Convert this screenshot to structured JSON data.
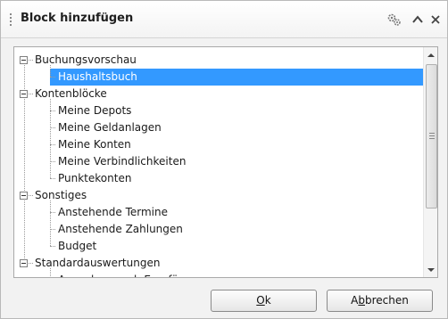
{
  "panel": {
    "title": "Block hinzufügen",
    "icons": [
      "settings-gear-icon",
      "collapse-chevron-up-icon",
      "close-x-icon"
    ]
  },
  "tree": {
    "groups": [
      {
        "label": "Buchungsvorschau",
        "children": [
          {
            "label": "Haushaltsbuch",
            "selected": true
          }
        ]
      },
      {
        "label": "Kontenblöcke",
        "children": [
          {
            "label": "Meine Depots"
          },
          {
            "label": "Meine Geldanlagen"
          },
          {
            "label": "Meine Konten"
          },
          {
            "label": "Meine Verbindlichkeiten"
          },
          {
            "label": "Punktekonten"
          }
        ]
      },
      {
        "label": "Sonstiges",
        "children": [
          {
            "label": "Anstehende Termine"
          },
          {
            "label": "Anstehende Zahlungen"
          },
          {
            "label": "Budget"
          }
        ]
      },
      {
        "label": "Standardauswertungen",
        "children": [
          {
            "label": "Ausgaben nach Empfänger"
          }
        ]
      }
    ]
  },
  "buttons": {
    "ok": {
      "mnemonic": "O",
      "rest": "k"
    },
    "cancel": {
      "before": "A",
      "mnemonic": "b",
      "rest": "brechen"
    }
  },
  "colors": {
    "selection": "#3399ff",
    "panel_bg": "#f2f2f2",
    "border": "#a9a9a9"
  }
}
